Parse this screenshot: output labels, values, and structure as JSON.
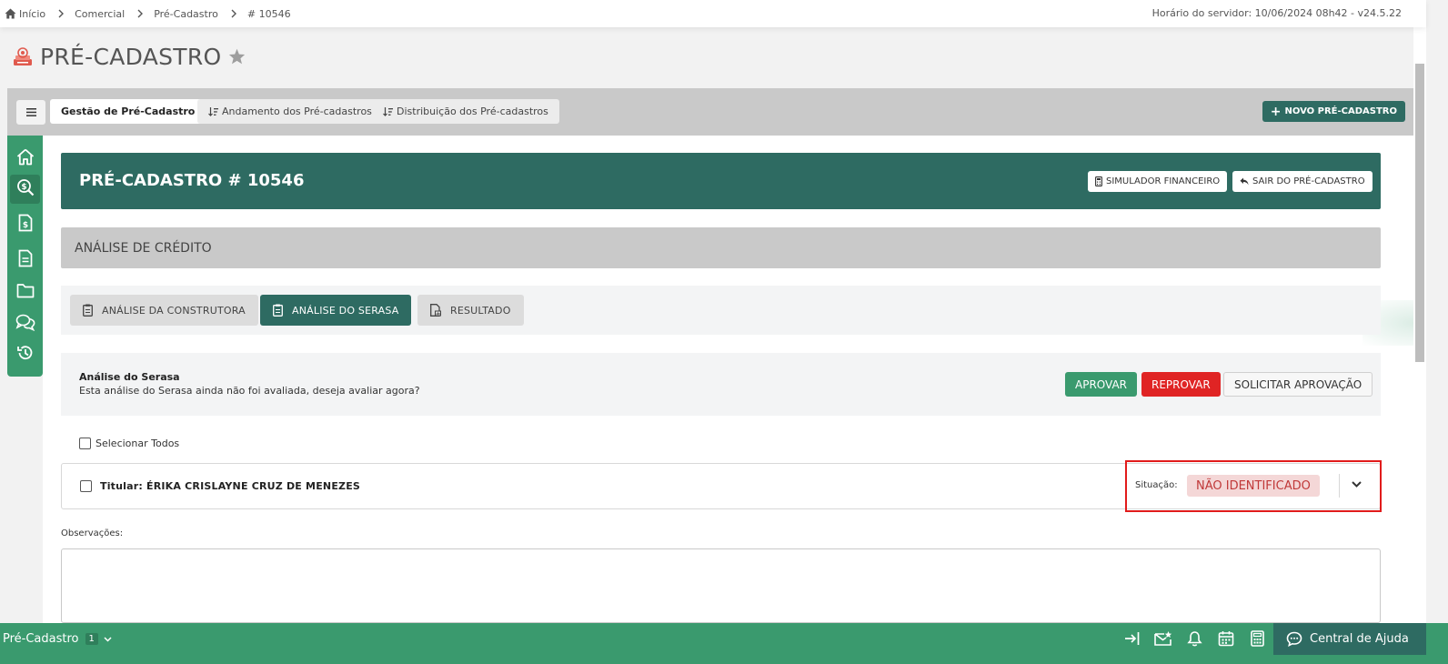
{
  "breadcrumb": {
    "items": [
      "Início",
      "Comercial",
      "Pré-Cadastro",
      "# 10546"
    ],
    "server_time": "Horário do servidor: 10/06/2024 08h42 - v24.5.22"
  },
  "page": {
    "title": "PRÉ-CADASTRO"
  },
  "tabs": {
    "items": [
      "Gestão de Pré-Cadastro",
      "Andamento dos Pré-cadastros",
      "Distribuição dos Pré-cadastros"
    ],
    "active": "Gestão de Pré-Cadastro",
    "new_button": "NOVO PRÉ-CADASTRO"
  },
  "rail": {
    "icons": [
      "home-icon",
      "search-dollar-icon",
      "file-dollar-icon",
      "document-icon",
      "folder-icon",
      "chat-icon",
      "history-icon"
    ],
    "active": "search-dollar-icon"
  },
  "record": {
    "title": "PRÉ-CADASTRO # 10546",
    "simulator_button": "SIMULADOR FINANCEIRO",
    "exit_button": "SAIR DO PRÉ-CADASTRO"
  },
  "section": {
    "title": "ANÁLISE DE CRÉDITO"
  },
  "subtabs": {
    "items": [
      "ANÁLISE DA CONSTRUTORA",
      "ANÁLISE DO SERASA",
      "RESULTADO"
    ],
    "active": "ANÁLISE DO SERASA"
  },
  "serasa": {
    "title": "Análise do Serasa",
    "description": "Esta análise do Serasa ainda não foi avaliada, deseja avaliar agora?",
    "approve": "APROVAR",
    "reject": "REPROVAR",
    "request": "SOLICITAR APROVAÇÃO"
  },
  "select_all": "Selecionar Todos",
  "titular": {
    "label": "Titular: ÉRIKA CRISLAYNE CRUZ DE MENEZES",
    "status_label": "Situação:",
    "status_value": "NÃO IDENTIFICADO"
  },
  "observations": {
    "label": "Observações:",
    "value": ""
  },
  "bottom": {
    "module": "Pré-Cadastro",
    "count": "1",
    "help": "Central de Ajuda"
  },
  "colors": {
    "primary_dark": "#2e6b62",
    "primary_green": "#3a9a6e",
    "danger": "#e02424",
    "status_bg": "#f4d7d7",
    "status_text": "#c03838"
  }
}
